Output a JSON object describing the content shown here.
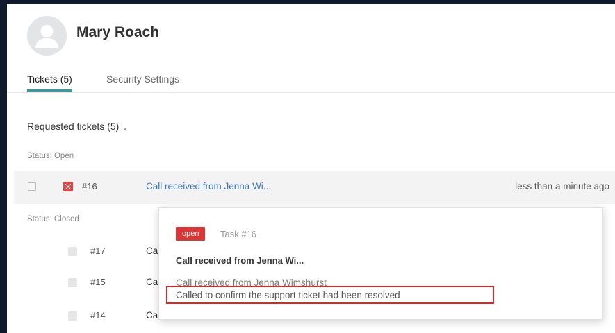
{
  "user": {
    "name": "Mary Roach"
  },
  "tabs": [
    {
      "label": "Tickets (5)"
    },
    {
      "label": "Security Settings"
    }
  ],
  "section": {
    "title": "Requested tickets (5)",
    "chevron": "⌄"
  },
  "status_open": "Status: Open",
  "status_closed": "Status: Closed",
  "tickets": [
    {
      "number": "#16",
      "subject": "Call received from Jenna Wi...",
      "time": "less than a minute ago"
    },
    {
      "number": "#17",
      "subject": "Ca"
    },
    {
      "number": "#15",
      "subject": "Ca"
    },
    {
      "number": "#14",
      "subject": "Ca"
    }
  ],
  "popup": {
    "badge": "open",
    "task": "Task #16",
    "title": "Call received from Jenna Wi...",
    "line1": "Call received from Jenna Wimshurst",
    "line2": "Called to confirm the support ticket had been resolved"
  },
  "colors": {
    "accent": "#2aa0a0",
    "link": "#3b76b5",
    "badge_red": "#d93636",
    "annotation": "#d62a2a"
  }
}
